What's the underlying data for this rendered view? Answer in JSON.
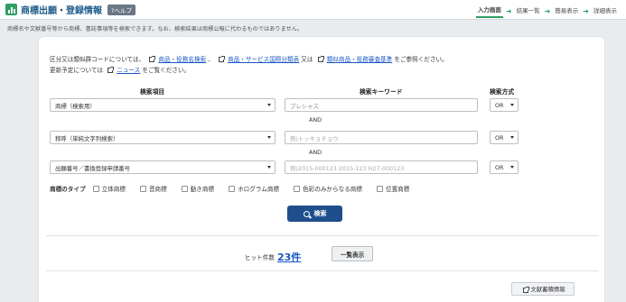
{
  "header": {
    "title": "商標出願・登録情報",
    "help": "?ヘルプ",
    "steps": [
      "入力画面",
      "結果一覧",
      "簡易表示",
      "詳細表示"
    ]
  },
  "description": "商標名や文献番号等から商標、書誌事項等を検索できます。なお、検索結果は商標公報に代わるものではありません。",
  "note": {
    "line1_prefix": "区分又は類似群コードについては、",
    "link1": "商品・役務名検索",
    "sep1": "、",
    "link2": "商品・サービス国際分類表",
    "sep2": "又は",
    "link3": "類似商品・役務審査基準",
    "line1_suffix": "をご参照ください。",
    "line2_prefix": "更新予定については",
    "link4": "ニュース",
    "line2_suffix": "をご覧ください。"
  },
  "columns": {
    "item": "検索項目",
    "keyword": "検索キーワード",
    "method": "検索方式"
  },
  "rows": [
    {
      "item": "商標（検索用）",
      "keyword": "プレシャス",
      "method": "OR"
    },
    {
      "item": "称呼（単純文字列検索）",
      "keyword": "例)トッキョチョウ",
      "method": "OR"
    },
    {
      "item": "出願番号／書換登録申請番号",
      "keyword": "例)2015-000123  2015-123  H27-000123",
      "method": "OR"
    }
  ],
  "and_label": "AND",
  "types": {
    "label": "商標のタイプ",
    "options": [
      "立体商標",
      "音商標",
      "動き商標",
      "ホログラム商標",
      "色彩のみからなる商標",
      "位置商標"
    ]
  },
  "search_button": "検索",
  "hits": {
    "label": "ヒット件数",
    "count": "23件"
  },
  "list_button": "一覧表示",
  "doc_button": "文献蓄積情報",
  "colors": {
    "accent": "#2e9e62",
    "primary": "#1e4f8c",
    "link": "#1a56c4"
  }
}
